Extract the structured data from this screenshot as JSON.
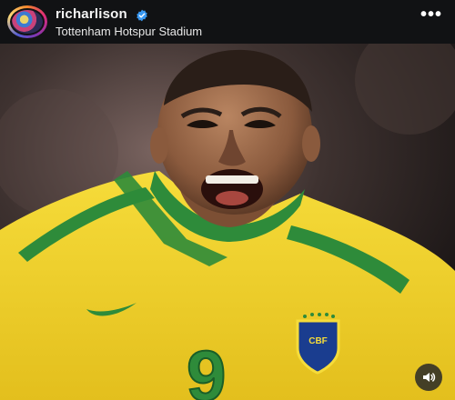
{
  "post_header": {
    "username": "richarlison",
    "location": "Tottenham Hotspur Stadium",
    "verified": true,
    "more_icon": "more-dots-icon"
  },
  "media": {
    "jersey_number": "9",
    "sound_icon": "speaker-icon"
  },
  "colors": {
    "header_bg": "#111214",
    "verified_blue": "#3897f0",
    "jersey_yellow": "#f2d22e",
    "jersey_green": "#2e8b3a"
  }
}
